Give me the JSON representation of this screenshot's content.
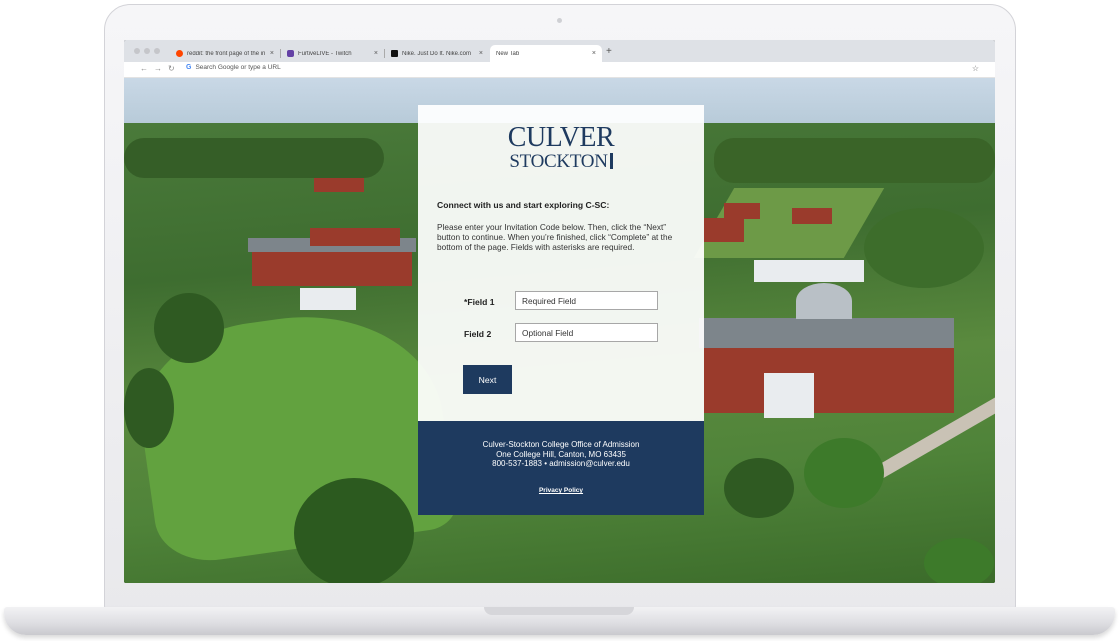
{
  "browser": {
    "tabs": [
      {
        "title": "reddit: the front page of the in",
        "favicon_color": "#ff4500",
        "active": false
      },
      {
        "title": "FurtiveLIVE - Twitch",
        "favicon_color": "#6441a5",
        "active": false
      },
      {
        "title": "Nike. Just Do It. Nike.com",
        "favicon_color": "#111111",
        "active": false
      },
      {
        "title": "New Tab",
        "favicon_color": "",
        "active": true
      }
    ],
    "new_tab_symbol": "+",
    "close_symbol": "×",
    "address_placeholder": "Search Google or type a URL",
    "google_glyph": "G",
    "nav": {
      "back": "←",
      "forward": "→",
      "reload": "↻"
    },
    "bookmark_star": "☆"
  },
  "logo": {
    "line1": "CULVER",
    "line2": "STOCKTON"
  },
  "form": {
    "heading": "Connect with us and start exploring C-SC:",
    "intro": "Please enter your Invitation Code below. Then, click the “Next” button to continue. When you’re finished, click “Complete” at the bottom of the page. Fields with asterisks are required.",
    "field1": {
      "label": "*Field 1",
      "placeholder": "Required Field"
    },
    "field2": {
      "label": "Field 2",
      "placeholder": "Optional Field"
    },
    "next_label": "Next"
  },
  "footer": {
    "line1": "Culver-Stockton College Office of Admission",
    "line2": "One College Hill, Canton, MO 63435",
    "line3": "800-537-1883 • admission@culver.edu",
    "privacy": "Privacy Policy"
  },
  "colors": {
    "brand_navy": "#1e3a5f",
    "tab_bar": "#dee1e6"
  }
}
